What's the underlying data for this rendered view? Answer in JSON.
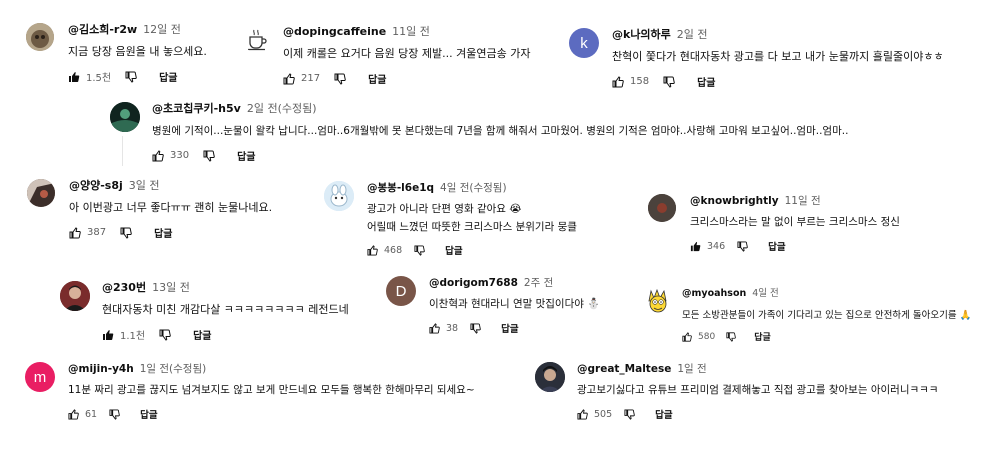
{
  "reply_label": "답글",
  "comments": [
    {
      "author": "@김소희-r2w",
      "time": "12일 전",
      "text": [
        "지금 당장 음원을 내 놓으세요."
      ],
      "likes": "1.5천",
      "avatar_color": "#8a7a62",
      "avatar_letter": ""
    },
    {
      "author": "@dopingcaffeine",
      "time": "11일 전",
      "text": [
        "이제 캐롤은 요거다 음원 당장 제발... 겨울연금송 가자"
      ],
      "likes": "217",
      "avatar_color": "#ffffff",
      "avatar_letter": ""
    },
    {
      "author": "@k나의하루",
      "time": "2일 전",
      "text": [
        "찬혁이 쫓다가 현대자동차 광고를 다 보고 내가 눈물까지 흘릴줄이야ㅎㅎ"
      ],
      "likes": "158",
      "avatar_color": "#5c6bc0",
      "avatar_letter": "k"
    },
    {
      "author": "@초코칩쿠키-h5v",
      "time": "2일 전(수정됨)",
      "text": [
        "병원에 기적이...눈물이 왈칵 납니다...엄마..6개월밖에 못 본다했는데 7년을 함께 해줘서 고마웠어. 병원의 기적은 엄마야..사랑해 고마워 보고싶어..엄마..엄마.."
      ],
      "likes": "330",
      "avatar_color": "#1c3a33",
      "avatar_letter": ""
    },
    {
      "author": "@양양-s8j",
      "time": "3일 전",
      "text": [
        "아 이번광고 너무 좋다ㅠㅠ 괜히 눈물나네요."
      ],
      "likes": "387",
      "avatar_color": "#4a3b36",
      "avatar_letter": ""
    },
    {
      "author": "@봉봉-l6e1q",
      "time": "4일 전(수정됨)",
      "text": [
        "광고가 아니라 단편 영화 같아요 😭",
        "어릴때 느꼈던 따뜻한 크리스마스 분위기라 뭉클"
      ],
      "likes": "468",
      "avatar_color": "#cfe3f2",
      "avatar_letter": ""
    },
    {
      "author": "@knowbrightly",
      "time": "11일 전",
      "text": [
        "크리스마스라는 말 없이 부르는 크리스마스 정신"
      ],
      "likes": "346",
      "avatar_color": "#4b423c",
      "avatar_letter": ""
    },
    {
      "author": "@230번",
      "time": "13일 전",
      "text": [
        "현대자동차 미친 개감다살 ㅋㅋㅋㅋㅋㅋㅋㅋ 레전드네"
      ],
      "likes": "1.1천",
      "avatar_color": "#5a2a2a",
      "avatar_letter": ""
    },
    {
      "author": "@dorigom7688",
      "time": "2주 전",
      "text": [
        "이찬혁과 현대라니 연말 맛집이다야 ⛄"
      ],
      "likes": "38",
      "avatar_color": "#795548",
      "avatar_letter": "D"
    },
    {
      "author": "@myoahson",
      "time": "4일 전",
      "text": [
        "모든 소방관분들이 가족이 기다리고 있는 집으로 안전하게 돌아오기를 🙏"
      ],
      "likes": "580",
      "avatar_color": "#fdd835",
      "avatar_letter": ""
    },
    {
      "author": "@mijin-y4h",
      "time": "1일 전(수정됨)",
      "text": [
        "11분 짜리 광고를 끊지도 넘겨보지도 않고 보게 만드네요 모두들 행복한 한해마무리 되세요~"
      ],
      "likes": "61",
      "avatar_color": "#e91e63",
      "avatar_letter": "m"
    },
    {
      "author": "@great_Maltese",
      "time": "1일 전",
      "text": [
        "광고보기싫다고 유튜브 프리미엄 결제해놓고 직접 광고를 찾아보는 아이러니ㅋㅋㅋ"
      ],
      "likes": "505",
      "avatar_color": "#2b2f3a",
      "avatar_letter": ""
    }
  ]
}
